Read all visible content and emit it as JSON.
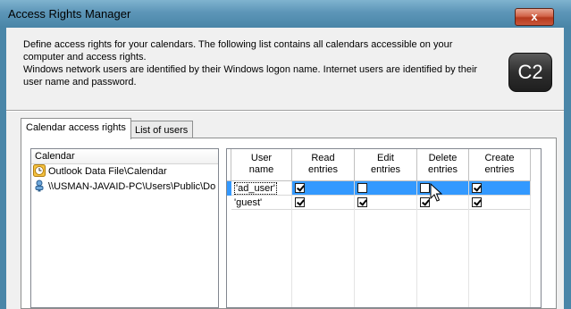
{
  "window": {
    "title": "Access Rights Manager",
    "close_label": "x"
  },
  "description": [
    "Define access rights for your calendars. The following list contains all calendars accessible on your",
    "computer and access rights.",
    "Windows network users are identified by their Windows logon name. Internet users are identified by their",
    "user name and password."
  ],
  "logo": {
    "text": "C2"
  },
  "tabs": [
    {
      "label": "Calendar access rights",
      "active": true
    },
    {
      "label": "List of users",
      "active": false
    }
  ],
  "calendars": {
    "header": "Calendar",
    "items": [
      {
        "label": "Outlook Data File\\Calendar",
        "icon": "calendar-clock-icon"
      },
      {
        "label": "\\\\USMAN-JAVAID-PC\\Users\\Public\\Do",
        "icon": "network-user-icon"
      }
    ]
  },
  "rights_grid": {
    "columns": [
      "User\nname",
      "Read\nentries",
      "Edit\nentries",
      "Delete\nentries",
      "Create\nentries"
    ],
    "rows": [
      {
        "user": "'ad_user'",
        "read": true,
        "edit": false,
        "delete": false,
        "create": true,
        "selected": true
      },
      {
        "user": "'guest'",
        "read": true,
        "edit": true,
        "delete": true,
        "create": true,
        "selected": false
      }
    ]
  },
  "colors": {
    "selection": "#3399ff",
    "titlebar": "#5d96b8",
    "close": "#c9563a"
  }
}
